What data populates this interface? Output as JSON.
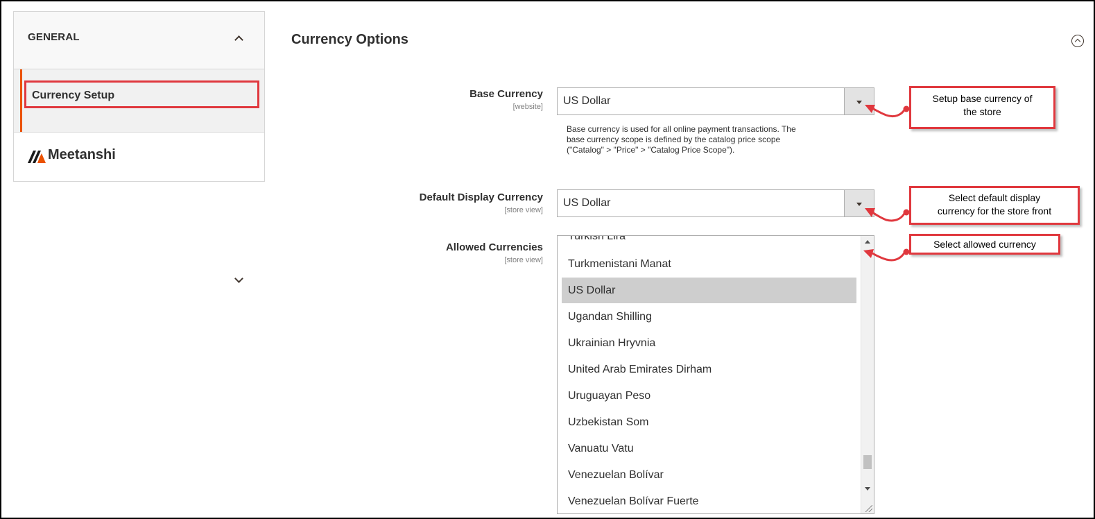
{
  "sidebar": {
    "section_title": "GENERAL",
    "active_item": "Currency Setup",
    "brand_name": "Meetanshi",
    "accent_color": "#eb5202"
  },
  "main": {
    "section_title": "Currency Options",
    "fields": {
      "base_currency": {
        "label": "Base Currency",
        "scope": "[website]",
        "value": "US Dollar",
        "note_lines": [
          "Base currency is used for all online payment transactions. The",
          "base currency scope is defined by the catalog price scope",
          "(\"Catalog\" > \"Price\" > \"Catalog Price Scope\")."
        ]
      },
      "default_display_currency": {
        "label": "Default Display Currency",
        "scope": "[store view]",
        "value": "US Dollar"
      },
      "allowed_currencies": {
        "label": "Allowed Currencies",
        "scope": "[store view]",
        "options": [
          "Turkish Lira",
          "Turkmenistani Manat",
          "US Dollar",
          "Ugandan Shilling",
          "Ukrainian Hryvnia",
          "United Arab Emirates Dirham",
          "Uruguayan Peso",
          "Uzbekistan Som",
          "Vanuatu Vatu",
          "Venezuelan Bolívar",
          "Venezuelan Bolívar Fuerte"
        ],
        "selected": "US Dollar"
      }
    }
  },
  "callouts": {
    "base": [
      "Setup base currency of",
      "the store"
    ],
    "display": [
      "Select default display",
      "currency for the store front"
    ],
    "allowed": [
      "Select allowed currency"
    ],
    "color": "#e0383e"
  }
}
